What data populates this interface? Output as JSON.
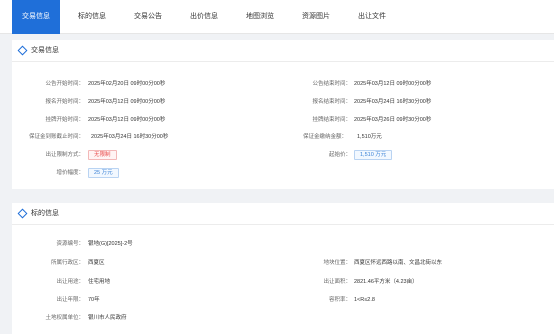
{
  "tabs": [
    {
      "label": "交易信息",
      "active": true
    },
    {
      "label": "标的信息",
      "active": false
    },
    {
      "label": "交易公告",
      "active": false
    },
    {
      "label": "出价信息",
      "active": false
    },
    {
      "label": "地图浏览",
      "active": false
    },
    {
      "label": "资源图片",
      "active": false
    },
    {
      "label": "出让文件",
      "active": false
    }
  ],
  "trade": {
    "title": "交易信息",
    "announce_start_label": "公告开始时间：",
    "announce_start": "2025年02月20日 09时00分00秒",
    "announce_end_label": "公告结束时间：",
    "announce_end": "2025年03月12日 09时00分00秒",
    "signup_start_label": "报名开始时间：",
    "signup_start": "2025年03月12日 09时00分00秒",
    "signup_end_label": "报名结束时间：",
    "signup_end": "2025年03月24日 16时30分00秒",
    "listing_start_label": "挂牌开始时间：",
    "listing_start": "2025年03月12日 09时00分00秒",
    "listing_end_label": "挂牌结束时间：",
    "listing_end": "2025年03月26日 09时30分00秒",
    "deposit_deadline_label": "保证金到账截止时间：",
    "deposit_deadline": "2025年03月24日 16时30分00秒",
    "deposit_amount_label": "保证金缴纳金额：",
    "deposit_amount": "1,510万元",
    "restriction_label": "出让限制方式：",
    "restriction": "无限制",
    "start_price_label": "起始价：",
    "start_price": "1,510 万元",
    "increment_label": "增价幅度：",
    "increment": "25 万元"
  },
  "subject": {
    "title": "标的信息",
    "resource_no_label": "资源编号：",
    "resource_no": "银地(G)[2025]-2号",
    "district_label": "所属行政区：",
    "district": "西夏区",
    "location_label": "地块位置：",
    "location": "西夏区怀远西路以南、文昌北街以东",
    "usage_label": "出让用途：",
    "usage": "住宅用地",
    "area_label": "出让面积：",
    "area": "2821.46平方米（4.23亩）",
    "term_label": "出让年限：",
    "term": "70年",
    "far_label": "容积率：",
    "far": "1<R≤2.8",
    "owner_label": "土地权属单位：",
    "owner": "银川市人民政府"
  },
  "colors": {
    "accent": "#1f6fd9",
    "tag_red": "#e94a4a",
    "tag_blue": "#3b82d6"
  }
}
